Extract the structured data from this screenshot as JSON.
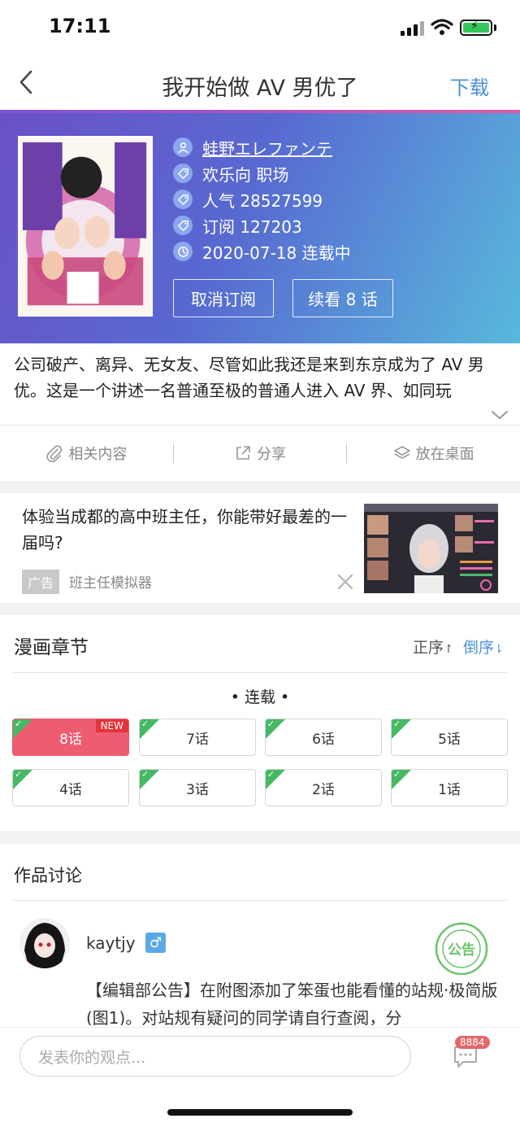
{
  "status_bar": {
    "time": "17:11"
  },
  "nav": {
    "title": "我开始做 AV 男优了",
    "download": "下载"
  },
  "comic": {
    "author": "蛙野エレファンテ",
    "genre": "欢乐向 职场",
    "popularity": "人气 28527599",
    "subscriptions": "订阅 127203",
    "update": "2020-07-18 连载中",
    "unsubscribe_button": "取消订阅",
    "continue_button": "续看 8 话",
    "description": "公司破产、离异、无女友、尽管如此我还是来到东京成为了 AV 男优。这是一个讲述一名普通至极的普通人进入 AV 界、如同玩"
  },
  "actions": {
    "related": "相关内容",
    "share": "分享",
    "desktop": "放在桌面"
  },
  "ad": {
    "text": "体验当成都的高中班主任，你能带好最差的一届吗?",
    "tag": "广告",
    "source": "班主任模拟器"
  },
  "chapters": {
    "title": "漫画章节",
    "order_asc": "正序",
    "order_desc": "倒序",
    "status": "•  连载  •",
    "items": [
      {
        "label": "8话",
        "new": "NEW"
      },
      {
        "label": "7话"
      },
      {
        "label": "6话"
      },
      {
        "label": "5话"
      },
      {
        "label": "4话"
      },
      {
        "label": "3话"
      },
      {
        "label": "2话"
      },
      {
        "label": "1话"
      }
    ]
  },
  "discussion": {
    "title": "作品讨论",
    "user": "kaytjy",
    "gender": "♂",
    "comment": "【编辑部公告】在附图添加了笨蛋也能看懂的站规·极简版 (图1)。对站规有疑问的同学请自行查阅，分"
  },
  "bottom": {
    "placeholder": "发表你的观点...",
    "comment_count": "8884"
  },
  "colors": {
    "accent": "#4a90d9",
    "active_chapter": "#ee5c72",
    "read_tick": "#46b964"
  }
}
